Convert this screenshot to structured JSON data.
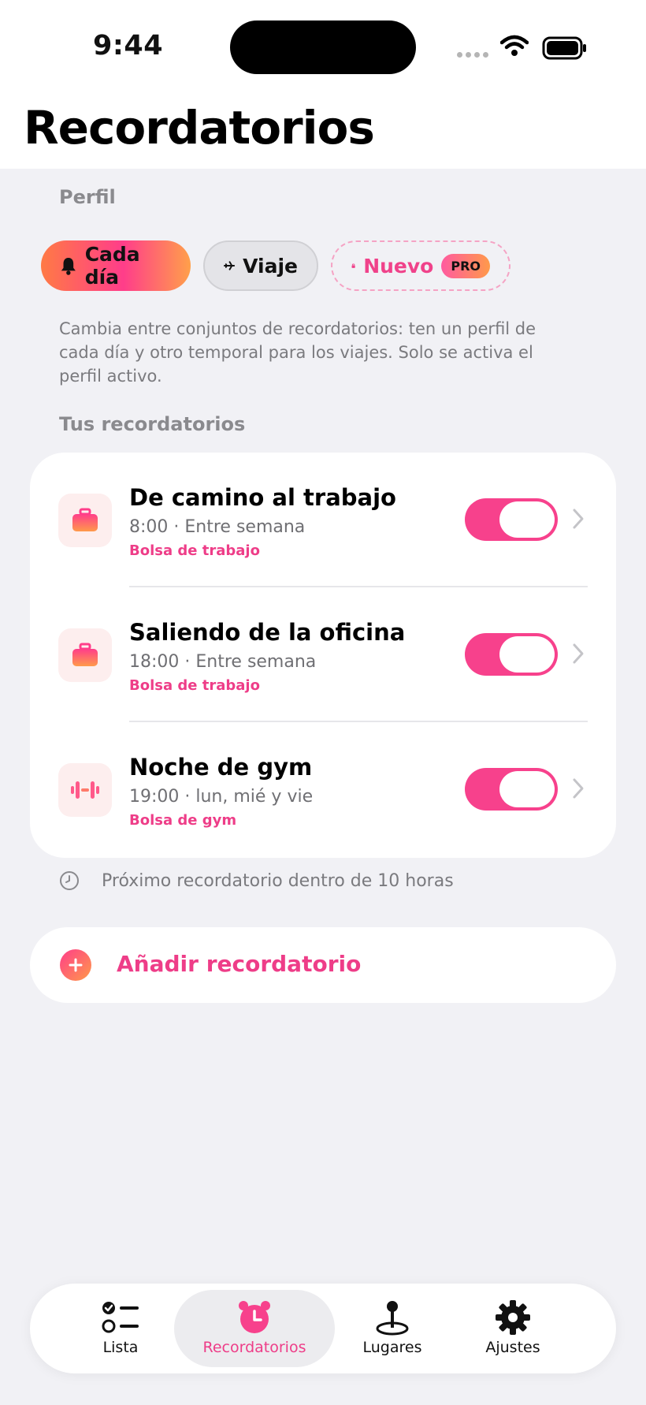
{
  "status_bar": {
    "time": "9:44"
  },
  "header": {
    "title": "Recordatorios"
  },
  "profile": {
    "section_label": "Perfil",
    "chips": [
      {
        "label": "Cada día",
        "icon": "bell-icon",
        "active": true
      },
      {
        "label": "Viaje",
        "icon": "airplane-icon",
        "active": false
      },
      {
        "label": "Nuevo",
        "icon": "lock-icon",
        "badge": "PRO",
        "active": false
      }
    ],
    "description": "Cambia entre conjuntos de recordatorios: ten un perfil de cada día y otro temporal para los viajes. Solo se activa el perfil activo."
  },
  "reminders": {
    "section_label": "Tus recordatorios",
    "items": [
      {
        "title": "De camino al trabajo",
        "subtitle": "8:00 · Entre semana",
        "bag": "Bolsa de trabajo",
        "icon": "briefcase-icon",
        "enabled": true
      },
      {
        "title": "Saliendo de la oficina",
        "subtitle": "18:00 · Entre semana",
        "bag": "Bolsa de trabajo",
        "icon": "briefcase-icon",
        "enabled": true
      },
      {
        "title": "Noche de gym",
        "subtitle": "19:00 · lun, mié y vie",
        "bag": "Bolsa de gym",
        "icon": "dumbbell-icon",
        "enabled": true
      }
    ],
    "next_note": "Próximo recordatorio dentro de 10 horas",
    "add_label": "Añadir recordatorio"
  },
  "tabbar": {
    "tabs": [
      {
        "label": "Lista",
        "icon": "checklist-icon",
        "active": false
      },
      {
        "label": "Recordatorios",
        "icon": "alarm-clock-icon",
        "active": true
      },
      {
        "label": "Lugares",
        "icon": "location-pin-icon",
        "active": false
      },
      {
        "label": "Ajustes",
        "icon": "gear-icon",
        "active": false
      }
    ]
  },
  "colors": {
    "accent": "#f7418c",
    "accent_orange": "#ff8a45",
    "background": "#f1f1f5"
  }
}
